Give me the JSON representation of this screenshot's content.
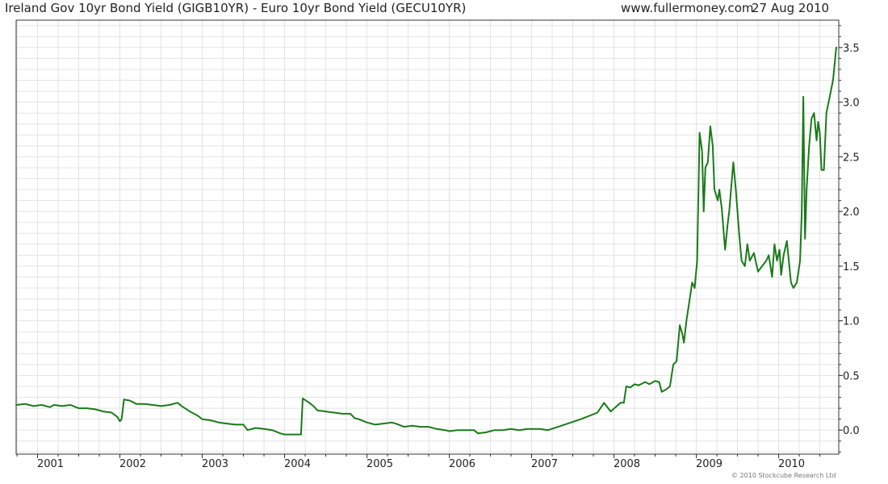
{
  "header": {
    "title": "Ireland Gov 10yr Bond Yield (GIGB10YR) - Euro 10yr Bond Yield (GECU10YR)",
    "source": "www.fullermoney.com",
    "date": "27 Aug 2010"
  },
  "footer": {
    "copyright": "© 2010 Stockcube Research Ltd"
  },
  "colors": {
    "line": "#1a7a1a",
    "grid": "#e3e3e3",
    "axis": "#333333"
  },
  "chart_data": {
    "type": "line",
    "title": "Ireland Gov 10yr Bond Yield (GIGB10YR) - Euro 10yr Bond Yield (GECU10YR)",
    "xlabel": "",
    "ylabel": "",
    "x_range": [
      2000.74,
      2010.73
    ],
    "ylim": [
      -0.22,
      3.75
    ],
    "y_ticks": [
      0.0,
      0.5,
      1.0,
      1.5,
      2.0,
      2.5,
      3.0,
      3.5
    ],
    "x_tick_labels": [
      "2001",
      "2002",
      "2003",
      "2004",
      "2005",
      "2006",
      "2007",
      "2008",
      "2009",
      "2010"
    ],
    "grid": true,
    "y_axis_side": "right",
    "series": [
      {
        "values": [
          [
            2000.74,
            0.23
          ],
          [
            2000.85,
            0.24
          ],
          [
            2000.95,
            0.22
          ],
          [
            2001.05,
            0.23
          ],
          [
            2001.15,
            0.21
          ],
          [
            2001.2,
            0.23
          ],
          [
            2001.3,
            0.22
          ],
          [
            2001.4,
            0.23
          ],
          [
            2001.5,
            0.2
          ],
          [
            2001.6,
            0.2
          ],
          [
            2001.7,
            0.19
          ],
          [
            2001.8,
            0.17
          ],
          [
            2001.9,
            0.16
          ],
          [
            2001.97,
            0.12
          ],
          [
            2002.0,
            0.08
          ],
          [
            2002.02,
            0.1
          ],
          [
            2002.05,
            0.28
          ],
          [
            2002.12,
            0.27
          ],
          [
            2002.2,
            0.24
          ],
          [
            2002.3,
            0.24
          ],
          [
            2002.4,
            0.23
          ],
          [
            2002.5,
            0.22
          ],
          [
            2002.6,
            0.23
          ],
          [
            2002.7,
            0.25
          ],
          [
            2002.75,
            0.22
          ],
          [
            2002.85,
            0.17
          ],
          [
            2002.95,
            0.13
          ],
          [
            2003.0,
            0.1
          ],
          [
            2003.1,
            0.09
          ],
          [
            2003.2,
            0.07
          ],
          [
            2003.3,
            0.06
          ],
          [
            2003.4,
            0.05
          ],
          [
            2003.5,
            0.05
          ],
          [
            2003.55,
            0.0
          ],
          [
            2003.65,
            0.02
          ],
          [
            2003.75,
            0.01
          ],
          [
            2003.85,
            0.0
          ],
          [
            2003.95,
            -0.03
          ],
          [
            2004.0,
            -0.04
          ],
          [
            2004.1,
            -0.04
          ],
          [
            2004.2,
            -0.04
          ],
          [
            2004.22,
            0.29
          ],
          [
            2004.3,
            0.25
          ],
          [
            2004.35,
            0.22
          ],
          [
            2004.4,
            0.18
          ],
          [
            2004.5,
            0.17
          ],
          [
            2004.6,
            0.16
          ],
          [
            2004.7,
            0.15
          ],
          [
            2004.8,
            0.15
          ],
          [
            2004.85,
            0.11
          ],
          [
            2004.9,
            0.1
          ],
          [
            2005.0,
            0.07
          ],
          [
            2005.1,
            0.05
          ],
          [
            2005.2,
            0.06
          ],
          [
            2005.3,
            0.07
          ],
          [
            2005.35,
            0.06
          ],
          [
            2005.45,
            0.03
          ],
          [
            2005.55,
            0.04
          ],
          [
            2005.65,
            0.03
          ],
          [
            2005.75,
            0.03
          ],
          [
            2005.85,
            0.01
          ],
          [
            2005.95,
            0.0
          ],
          [
            2006.0,
            -0.01
          ],
          [
            2006.1,
            0.0
          ],
          [
            2006.2,
            0.0
          ],
          [
            2006.3,
            0.0
          ],
          [
            2006.35,
            -0.03
          ],
          [
            2006.45,
            -0.02
          ],
          [
            2006.55,
            0.0
          ],
          [
            2006.65,
            0.0
          ],
          [
            2006.75,
            0.01
          ],
          [
            2006.85,
            0.0
          ],
          [
            2006.95,
            0.01
          ],
          [
            2007.1,
            0.01
          ],
          [
            2007.2,
            0.0
          ],
          [
            2007.4,
            0.05
          ],
          [
            2007.6,
            0.1
          ],
          [
            2007.8,
            0.16
          ],
          [
            2007.88,
            0.25
          ],
          [
            2007.93,
            0.2
          ],
          [
            2007.96,
            0.17
          ],
          [
            2008.02,
            0.21
          ],
          [
            2008.08,
            0.25
          ],
          [
            2008.12,
            0.25
          ],
          [
            2008.15,
            0.4
          ],
          [
            2008.2,
            0.39
          ],
          [
            2008.25,
            0.42
          ],
          [
            2008.3,
            0.41
          ],
          [
            2008.38,
            0.44
          ],
          [
            2008.43,
            0.42
          ],
          [
            2008.5,
            0.45
          ],
          [
            2008.55,
            0.44
          ],
          [
            2008.58,
            0.35
          ],
          [
            2008.63,
            0.37
          ],
          [
            2008.68,
            0.4
          ],
          [
            2008.72,
            0.6
          ],
          [
            2008.76,
            0.63
          ],
          [
            2008.8,
            0.96
          ],
          [
            2008.83,
            0.88
          ],
          [
            2008.85,
            0.8
          ],
          [
            2008.88,
            1.0
          ],
          [
            2008.92,
            1.2
          ],
          [
            2008.95,
            1.35
          ],
          [
            2008.98,
            1.3
          ],
          [
            2009.01,
            1.55
          ],
          [
            2009.04,
            2.72
          ],
          [
            2009.07,
            2.55
          ],
          [
            2009.09,
            2.0
          ],
          [
            2009.11,
            2.4
          ],
          [
            2009.14,
            2.45
          ],
          [
            2009.17,
            2.78
          ],
          [
            2009.2,
            2.6
          ],
          [
            2009.22,
            2.2
          ],
          [
            2009.26,
            2.1
          ],
          [
            2009.28,
            2.2
          ],
          [
            2009.31,
            2.02
          ],
          [
            2009.35,
            1.65
          ],
          [
            2009.38,
            1.88
          ],
          [
            2009.4,
            2.0
          ],
          [
            2009.45,
            2.45
          ],
          [
            2009.48,
            2.2
          ],
          [
            2009.52,
            1.8
          ],
          [
            2009.55,
            1.55
          ],
          [
            2009.59,
            1.5
          ],
          [
            2009.62,
            1.7
          ],
          [
            2009.65,
            1.55
          ],
          [
            2009.7,
            1.62
          ],
          [
            2009.75,
            1.45
          ],
          [
            2009.8,
            1.5
          ],
          [
            2009.85,
            1.55
          ],
          [
            2009.88,
            1.6
          ],
          [
            2009.92,
            1.4
          ],
          [
            2009.95,
            1.7
          ],
          [
            2009.98,
            1.55
          ],
          [
            2010.01,
            1.65
          ],
          [
            2010.03,
            1.42
          ],
          [
            2010.06,
            1.6
          ],
          [
            2010.1,
            1.73
          ],
          [
            2010.13,
            1.5
          ],
          [
            2010.15,
            1.35
          ],
          [
            2010.18,
            1.3
          ],
          [
            2010.22,
            1.35
          ],
          [
            2010.26,
            1.55
          ],
          [
            2010.28,
            1.98
          ],
          [
            2010.3,
            3.05
          ],
          [
            2010.32,
            1.75
          ],
          [
            2010.34,
            2.2
          ],
          [
            2010.37,
            2.6
          ],
          [
            2010.4,
            2.85
          ],
          [
            2010.43,
            2.9
          ],
          [
            2010.46,
            2.65
          ],
          [
            2010.48,
            2.82
          ],
          [
            2010.5,
            2.72
          ],
          [
            2010.52,
            2.38
          ],
          [
            2010.55,
            2.38
          ],
          [
            2010.58,
            2.9
          ],
          [
            2010.62,
            3.05
          ],
          [
            2010.66,
            3.2
          ],
          [
            2010.7,
            3.5
          ]
        ]
      }
    ]
  }
}
